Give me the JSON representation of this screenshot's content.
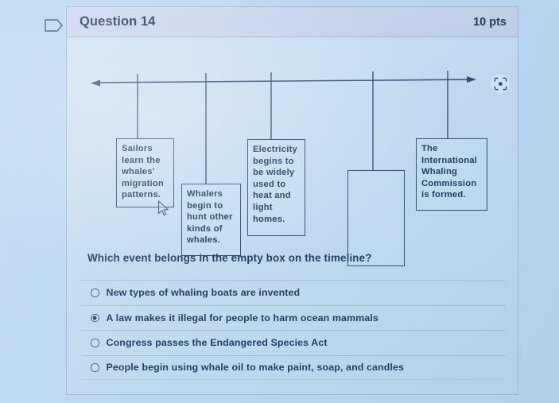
{
  "header": {
    "question_label": "Question 14",
    "points_label": "10 pts",
    "flag_icon": "flag-icon"
  },
  "timeline": {
    "focus_icon": "focus-target-icon",
    "axis": {
      "left_arrow": true,
      "right_arrow": true,
      "tick_count": 5
    },
    "events": [
      {
        "id": "event-1",
        "text": "Sailors learn the whales' migration patterns.",
        "empty": false
      },
      {
        "id": "event-2",
        "text": "Whalers begin to hunt other kinds of whales.",
        "empty": false
      },
      {
        "id": "event-3",
        "text": "Electricity begins to be widely used to heat and light homes.",
        "empty": false
      },
      {
        "id": "event-4",
        "text": "",
        "empty": true
      },
      {
        "id": "event-5",
        "text": "The International Whaling Commission is formed.",
        "empty": false
      }
    ]
  },
  "question": {
    "prompt": "Which event belongs in the empty box on the timeline?",
    "options": [
      {
        "label": "New types of whaling boats are invented",
        "selected": false
      },
      {
        "label": "A law makes it illegal for people to harm ocean mammals",
        "selected": true
      },
      {
        "label": "Congress passes the Endangered Species Act",
        "selected": false
      },
      {
        "label": "People begin using whale oil to make paint, soap, and candles",
        "selected": false
      }
    ]
  },
  "colors": {
    "page_background": "#b9d6ef",
    "card_background": "#c6ddf1",
    "header_background": "#c4d2ea",
    "ink": "#1d3557",
    "line": "#2b4a73"
  },
  "cursor": {
    "icon": "mouse-pointer-icon"
  }
}
